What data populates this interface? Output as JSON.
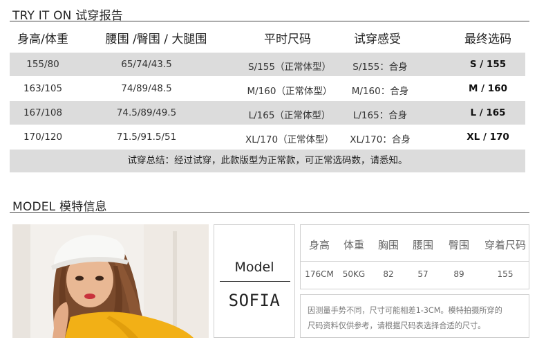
{
  "fitting": {
    "title": "TRY IT ON 试穿报告",
    "headers": [
      "身高/体重",
      "腰围 /臀围 / 大腿围",
      "平时尺码",
      "试穿感受",
      "最终选码"
    ],
    "rows": [
      [
        "155/80",
        "65/74/43.5",
        "S/155（正常体型）",
        "S/155：合身",
        "S / 155"
      ],
      [
        "163/105",
        "74/89/48.5",
        "M/160（正常体型）",
        "M/160：合身",
        "M / 160"
      ],
      [
        "167/108",
        "74.5/89/49.5",
        "L/165（正常体型）",
        "L/165：合身",
        "L / 165"
      ],
      [
        "170/120",
        "71.5/91.5/51",
        "XL/170（正常体型）",
        "XL/170：合身",
        "XL / 170"
      ]
    ],
    "summary": "试穿总结：经过试穿，此款版型为正常款，可正常选码数，请悉知。"
  },
  "model": {
    "title": "MODEL 模特信息",
    "label": "Model",
    "name": "SOFIA",
    "stat_headers": [
      "身高",
      "体重",
      "胸围",
      "腰围",
      "臀围",
      "穿着尺码"
    ],
    "stat_values": [
      "176CM",
      "50KG",
      "82",
      "57",
      "89",
      "155"
    ],
    "note_line1": "因测量手势不同，尺寸可能相差1-3CM。模特拍摄所穿的",
    "note_line2": "尺码资料仅供参考，请根据尺码表选择合适的尺寸。"
  },
  "colors": {
    "row_gray": "#dcdcdc",
    "cap": "#f8f8f6",
    "hair": "#7a4a2c",
    "shirt": "#f2b016",
    "lips": "#c8323c"
  }
}
